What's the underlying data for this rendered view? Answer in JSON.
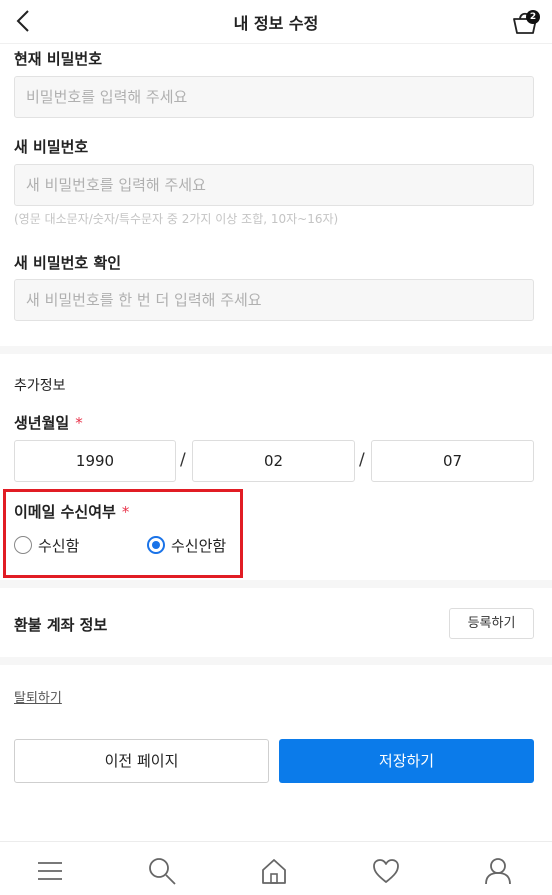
{
  "header": {
    "title": "내 정보 수정",
    "cart_count": "2"
  },
  "form": {
    "current_password": {
      "label": "현재 비밀번호",
      "placeholder": "비밀번호를 입력해 주세요"
    },
    "new_password": {
      "label": "새 비밀번호",
      "placeholder": "새 비밀번호를 입력해 주세요",
      "hint": "(영문 대소문자/숫자/특수문자 중 2가지 이상 조합, 10자~16자)"
    },
    "confirm_password": {
      "label": "새 비밀번호 확인",
      "placeholder": "새 비밀번호를 한 번 더 입력해 주세요"
    }
  },
  "extra": {
    "title": "추가정보",
    "birthday": {
      "label": "생년월일",
      "required_mark": "*",
      "year": "1990",
      "month": "02",
      "day": "07",
      "separator": "/"
    },
    "email_opt": {
      "label": "이메일 수신여부",
      "required_mark": "*",
      "option_yes": "수신함",
      "option_no": "수신안함",
      "selected": "수신안함"
    }
  },
  "refund": {
    "title": "환불 계좌 정보",
    "register_label": "등록하기"
  },
  "withdraw_label": "탈퇴하기",
  "actions": {
    "prev_label": "이전 페이지",
    "save_label": "저장하기"
  },
  "colors": {
    "primary": "#0b7bea",
    "required": "#e8334a",
    "highlight": "#e11c24"
  },
  "tabbar": {
    "icons": [
      "menu-icon",
      "search-icon",
      "home-icon",
      "heart-icon",
      "user-icon"
    ]
  }
}
